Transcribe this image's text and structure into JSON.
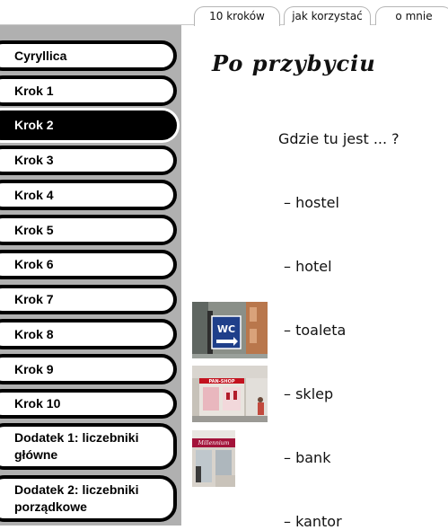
{
  "tabs": [
    {
      "label": "10 kroków",
      "active": true
    },
    {
      "label": "jak korzystać",
      "active": false
    },
    {
      "label": "o mnie",
      "active": false
    }
  ],
  "sidebar": {
    "items": [
      {
        "label": "Cyryllica",
        "active": false
      },
      {
        "label": "Krok 1",
        "active": false
      },
      {
        "label": "Krok 2",
        "active": true
      },
      {
        "label": "Krok 3",
        "active": false
      },
      {
        "label": "Krok 4",
        "active": false
      },
      {
        "label": "Krok 5",
        "active": false
      },
      {
        "label": "Krok 6",
        "active": false
      },
      {
        "label": "Krok 7",
        "active": false
      },
      {
        "label": "Krok 8",
        "active": false
      },
      {
        "label": "Krok 9",
        "active": false
      },
      {
        "label": "Krok 10",
        "active": false
      },
      {
        "label": "Dodatek 1: liczebniki główne",
        "active": false
      },
      {
        "label": "Dodatek 2: liczebniki porządkowe",
        "active": false
      }
    ]
  },
  "main": {
    "title": "Po przybyciu",
    "question": "Gdzie tu jest ... ?",
    "words": [
      {
        "text": "– hostel"
      },
      {
        "text": "– hotel"
      },
      {
        "text": "– toaleta",
        "photo": "wc-sign-photo"
      },
      {
        "text": "– sklep",
        "photo": "shop-front-photo"
      },
      {
        "text": "– bank",
        "photo": "bank-front-photo"
      },
      {
        "text": "– kantor"
      }
    ],
    "photos": {
      "wc_sign_text": "WC",
      "shop_sign_text": "PAN-SHOP",
      "bank_sign_text": "Millennium"
    }
  },
  "colors": {
    "sidebar_bg": "#b0b0b0",
    "nav_active_bg": "#000000",
    "nav_border": "#000000"
  }
}
